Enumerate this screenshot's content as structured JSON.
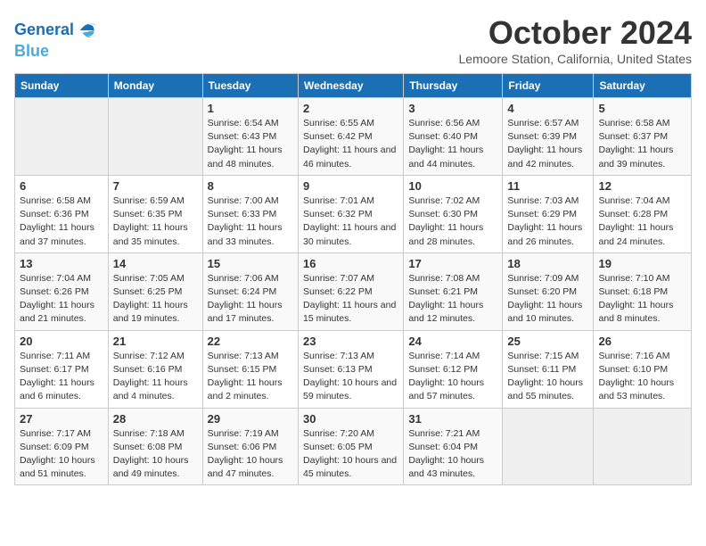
{
  "logo": {
    "line1": "General",
    "line2": "Blue"
  },
  "title": "October 2024",
  "subtitle": "Lemoore Station, California, United States",
  "days_of_week": [
    "Sunday",
    "Monday",
    "Tuesday",
    "Wednesday",
    "Thursday",
    "Friday",
    "Saturday"
  ],
  "weeks": [
    [
      {
        "num": "",
        "info": ""
      },
      {
        "num": "",
        "info": ""
      },
      {
        "num": "1",
        "info": "Sunrise: 6:54 AM\nSunset: 6:43 PM\nDaylight: 11 hours and 48 minutes."
      },
      {
        "num": "2",
        "info": "Sunrise: 6:55 AM\nSunset: 6:42 PM\nDaylight: 11 hours and 46 minutes."
      },
      {
        "num": "3",
        "info": "Sunrise: 6:56 AM\nSunset: 6:40 PM\nDaylight: 11 hours and 44 minutes."
      },
      {
        "num": "4",
        "info": "Sunrise: 6:57 AM\nSunset: 6:39 PM\nDaylight: 11 hours and 42 minutes."
      },
      {
        "num": "5",
        "info": "Sunrise: 6:58 AM\nSunset: 6:37 PM\nDaylight: 11 hours and 39 minutes."
      }
    ],
    [
      {
        "num": "6",
        "info": "Sunrise: 6:58 AM\nSunset: 6:36 PM\nDaylight: 11 hours and 37 minutes."
      },
      {
        "num": "7",
        "info": "Sunrise: 6:59 AM\nSunset: 6:35 PM\nDaylight: 11 hours and 35 minutes."
      },
      {
        "num": "8",
        "info": "Sunrise: 7:00 AM\nSunset: 6:33 PM\nDaylight: 11 hours and 33 minutes."
      },
      {
        "num": "9",
        "info": "Sunrise: 7:01 AM\nSunset: 6:32 PM\nDaylight: 11 hours and 30 minutes."
      },
      {
        "num": "10",
        "info": "Sunrise: 7:02 AM\nSunset: 6:30 PM\nDaylight: 11 hours and 28 minutes."
      },
      {
        "num": "11",
        "info": "Sunrise: 7:03 AM\nSunset: 6:29 PM\nDaylight: 11 hours and 26 minutes."
      },
      {
        "num": "12",
        "info": "Sunrise: 7:04 AM\nSunset: 6:28 PM\nDaylight: 11 hours and 24 minutes."
      }
    ],
    [
      {
        "num": "13",
        "info": "Sunrise: 7:04 AM\nSunset: 6:26 PM\nDaylight: 11 hours and 21 minutes."
      },
      {
        "num": "14",
        "info": "Sunrise: 7:05 AM\nSunset: 6:25 PM\nDaylight: 11 hours and 19 minutes."
      },
      {
        "num": "15",
        "info": "Sunrise: 7:06 AM\nSunset: 6:24 PM\nDaylight: 11 hours and 17 minutes."
      },
      {
        "num": "16",
        "info": "Sunrise: 7:07 AM\nSunset: 6:22 PM\nDaylight: 11 hours and 15 minutes."
      },
      {
        "num": "17",
        "info": "Sunrise: 7:08 AM\nSunset: 6:21 PM\nDaylight: 11 hours and 12 minutes."
      },
      {
        "num": "18",
        "info": "Sunrise: 7:09 AM\nSunset: 6:20 PM\nDaylight: 11 hours and 10 minutes."
      },
      {
        "num": "19",
        "info": "Sunrise: 7:10 AM\nSunset: 6:18 PM\nDaylight: 11 hours and 8 minutes."
      }
    ],
    [
      {
        "num": "20",
        "info": "Sunrise: 7:11 AM\nSunset: 6:17 PM\nDaylight: 11 hours and 6 minutes."
      },
      {
        "num": "21",
        "info": "Sunrise: 7:12 AM\nSunset: 6:16 PM\nDaylight: 11 hours and 4 minutes."
      },
      {
        "num": "22",
        "info": "Sunrise: 7:13 AM\nSunset: 6:15 PM\nDaylight: 11 hours and 2 minutes."
      },
      {
        "num": "23",
        "info": "Sunrise: 7:13 AM\nSunset: 6:13 PM\nDaylight: 10 hours and 59 minutes."
      },
      {
        "num": "24",
        "info": "Sunrise: 7:14 AM\nSunset: 6:12 PM\nDaylight: 10 hours and 57 minutes."
      },
      {
        "num": "25",
        "info": "Sunrise: 7:15 AM\nSunset: 6:11 PM\nDaylight: 10 hours and 55 minutes."
      },
      {
        "num": "26",
        "info": "Sunrise: 7:16 AM\nSunset: 6:10 PM\nDaylight: 10 hours and 53 minutes."
      }
    ],
    [
      {
        "num": "27",
        "info": "Sunrise: 7:17 AM\nSunset: 6:09 PM\nDaylight: 10 hours and 51 minutes."
      },
      {
        "num": "28",
        "info": "Sunrise: 7:18 AM\nSunset: 6:08 PM\nDaylight: 10 hours and 49 minutes."
      },
      {
        "num": "29",
        "info": "Sunrise: 7:19 AM\nSunset: 6:06 PM\nDaylight: 10 hours and 47 minutes."
      },
      {
        "num": "30",
        "info": "Sunrise: 7:20 AM\nSunset: 6:05 PM\nDaylight: 10 hours and 45 minutes."
      },
      {
        "num": "31",
        "info": "Sunrise: 7:21 AM\nSunset: 6:04 PM\nDaylight: 10 hours and 43 minutes."
      },
      {
        "num": "",
        "info": ""
      },
      {
        "num": "",
        "info": ""
      }
    ]
  ]
}
